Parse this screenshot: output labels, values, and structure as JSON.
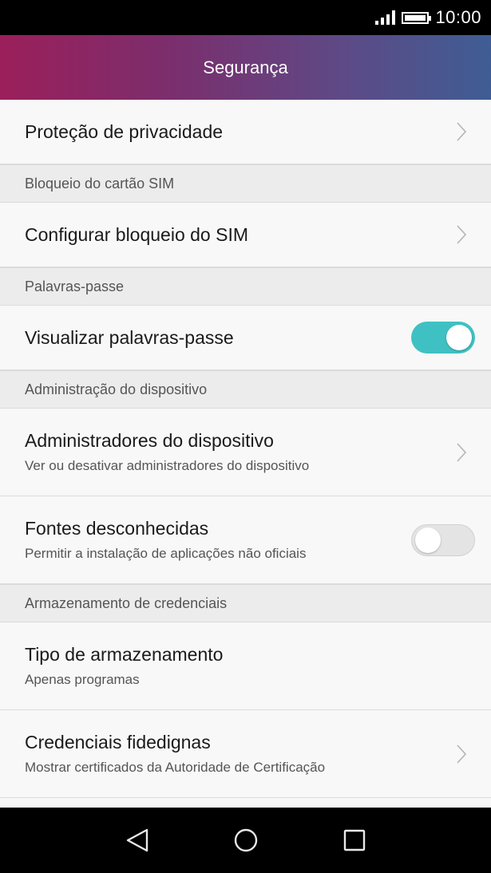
{
  "status_bar": {
    "time": "10:00"
  },
  "header": {
    "title": "Segurança",
    "gradient_colors": [
      "#9b1f5a",
      "#3f5d94"
    ]
  },
  "items": {
    "privacy": {
      "title": "Proteção de privacidade",
      "control": "chevron"
    },
    "sim_section": {
      "label": "Bloqueio do cartão SIM"
    },
    "sim_lock": {
      "title": "Configurar bloqueio do SIM",
      "control": "chevron"
    },
    "passwords_section": {
      "label": "Palavras-passe"
    },
    "show_passwords": {
      "title": "Visualizar palavras-passe",
      "control": "toggle",
      "enabled": true
    },
    "device_admin_section": {
      "label": "Administração do dispositivo"
    },
    "device_admins": {
      "title": "Administradores do dispositivo",
      "subtitle": "Ver ou desativar administradores do dispositivo",
      "control": "chevron"
    },
    "unknown_sources": {
      "title": "Fontes desconhecidas",
      "subtitle": "Permitir a instalação de aplicações não oficiais",
      "control": "toggle",
      "enabled": false
    },
    "credential_section": {
      "label": "Armazenamento de credenciais"
    },
    "storage_type": {
      "title": "Tipo de armazenamento",
      "subtitle": "Apenas programas"
    },
    "trusted_credentials": {
      "title": "Credenciais fidedignas",
      "subtitle": "Mostrar certificados da Autoridade de Certificação",
      "control": "chevron"
    }
  },
  "colors": {
    "toggle_on": "#3fc1c3",
    "toggle_off": "#e4e4e4"
  },
  "nav_bar": {
    "icons": [
      "back-icon",
      "home-icon",
      "recents-icon"
    ]
  }
}
